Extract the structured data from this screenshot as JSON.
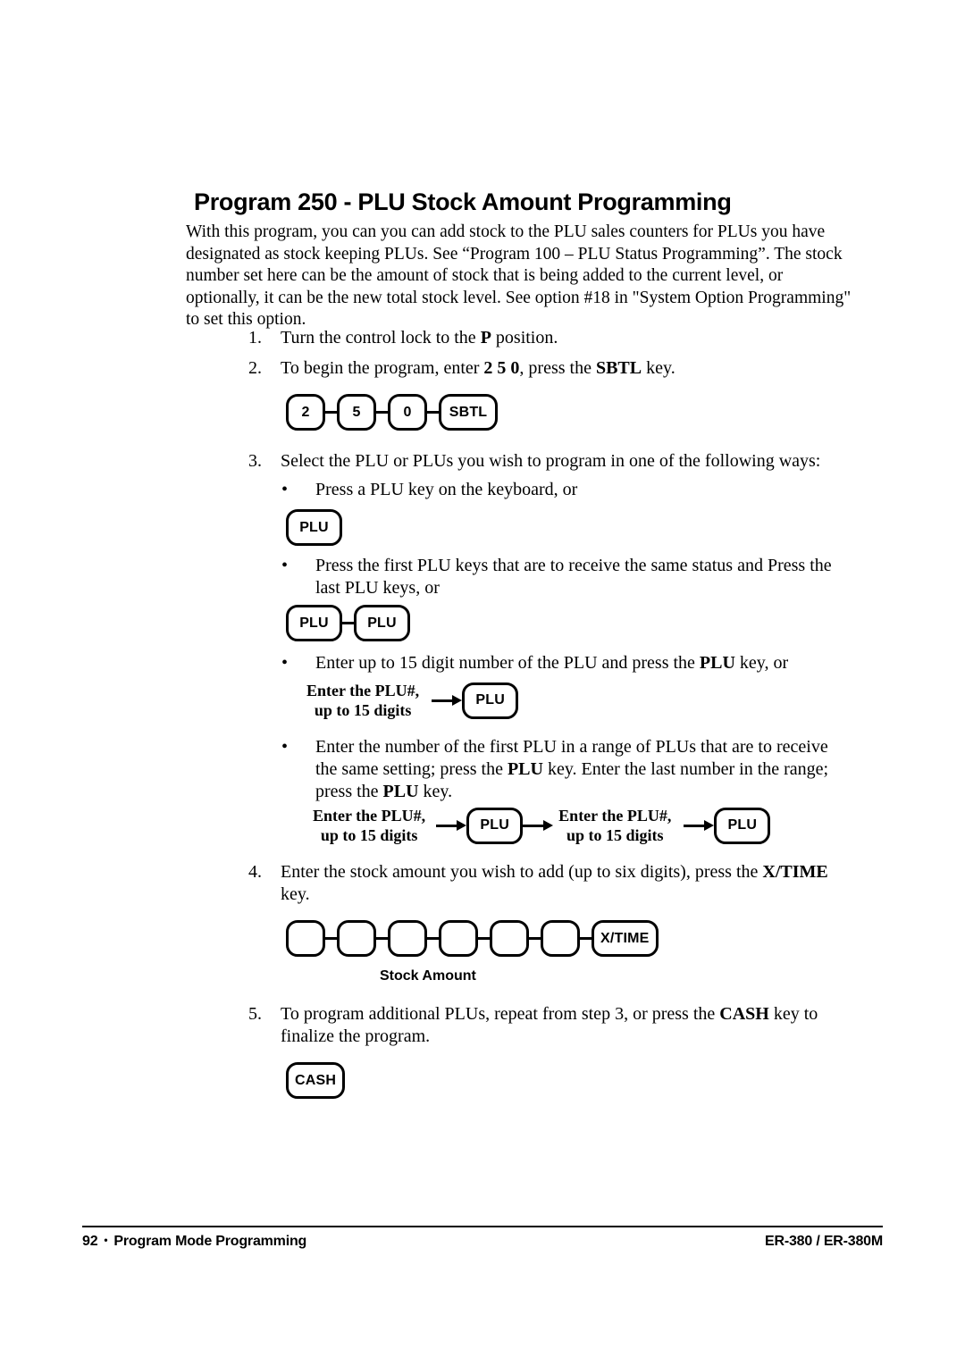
{
  "document": {
    "title": "Program 250 - PLU Stock Amount Programming",
    "intro": "With this program, you can you can add stock to the PLU sales counters for PLUs you have designated as stock keeping PLUs.   See “Program 100 – PLU Status Programming”.   The stock number set here can be the amount of stock that is being added to the current level, or optionally, it can be the new total stock level.   See option #18 in \"System Option Programming\" to set this option."
  },
  "steps": [
    {
      "number": "1.",
      "text_before": "Turn the control lock to the ",
      "bold": "P",
      "text_after": " position."
    },
    {
      "number": "2.",
      "text_before": "To begin the program, enter ",
      "bold": "2 5 0",
      "text_mid": ", press the ",
      "bold2": "SBTL",
      "text_after": " key."
    },
    {
      "number": "3.",
      "text_before": "Select the PLU or PLUs you wish to program in one of the following ways:"
    },
    {
      "number": "4.",
      "text_before": "Enter the stock amount you wish to add (up to six digits), press the ",
      "bold": "X/TIME",
      "text_after": " key."
    },
    {
      "number": "5.",
      "text_before": "To program additional PLUs, repeat from step 3, or press the ",
      "bold": "CASH",
      "text_after": " key to finalize the program."
    }
  ],
  "bullets": [
    {
      "marker": "•",
      "text": "Press a PLU key on the keyboard, or"
    },
    {
      "marker": "•",
      "text": "Press the first PLU keys that are to receive the same status and Press the last PLU keys, or"
    },
    {
      "marker": "•",
      "text_before": "Enter up to 15 digit number of the PLU and press the ",
      "bold": "PLU",
      "text_after": " key, or"
    },
    {
      "marker": "•",
      "text_before": "Enter the number of the first PLU in a range of PLUs that are to receive the same setting; press the ",
      "bold": "PLU",
      "text_mid": " key.   Enter the last number in the range; press the ",
      "bold2": "PLU",
      "text_after": " key."
    }
  ],
  "diagrams": {
    "sequence_250": {
      "keys": [
        "2",
        "5",
        "0",
        "SBTL"
      ]
    },
    "single_plu": {
      "keys": [
        "PLU"
      ]
    },
    "double_plu": {
      "keys": [
        "PLU",
        "PLU"
      ]
    },
    "plu_number_entry": {
      "label_line1": "Enter the PLU#,",
      "label_line2": "up to 15 digits",
      "key": "PLU"
    },
    "plu_range_entry": {
      "label1_line1": "Enter the PLU#,",
      "label1_line2": "up to 15 digits",
      "key1": "PLU",
      "label2_line1": "Enter the PLU#,",
      "label2_line2": "up to 15 digits",
      "key2": "PLU"
    },
    "stock_amount_entry": {
      "blank_keys": [
        "",
        "",
        "",
        "",
        "",
        ""
      ],
      "final_key": "X/TIME",
      "caption": "Stock Amount"
    },
    "cash_key": {
      "key": "CASH"
    }
  },
  "footer": {
    "page_number": "92",
    "separator": "•",
    "section": "Program Mode Programming",
    "model": "ER-380 / ER-380M"
  }
}
